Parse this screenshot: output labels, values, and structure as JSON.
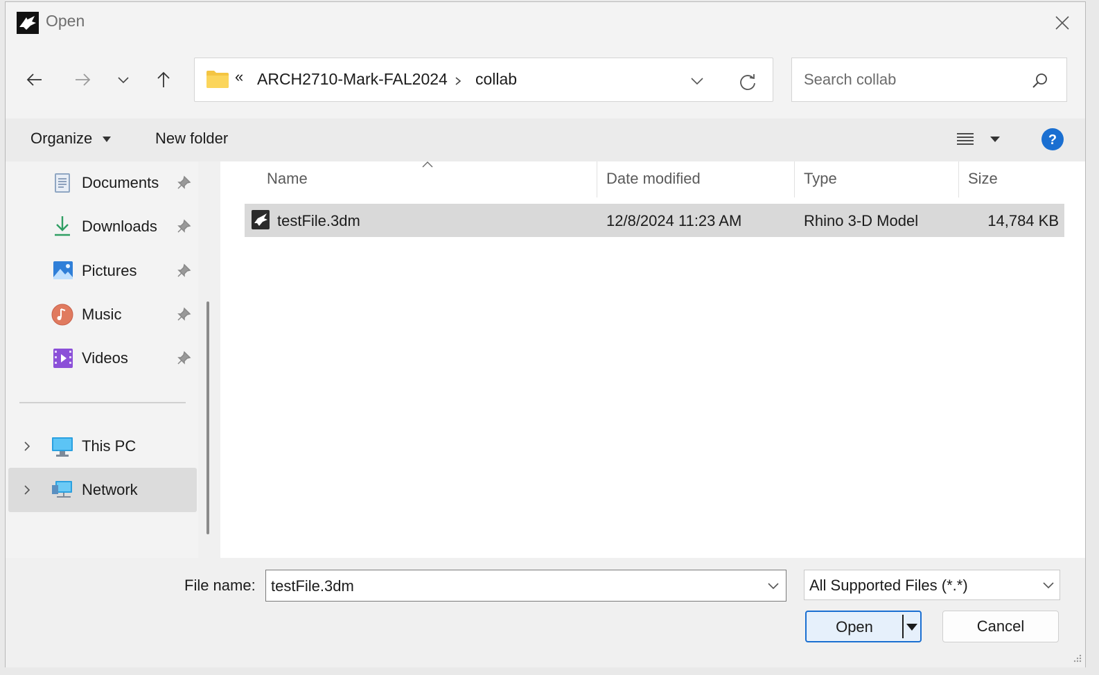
{
  "window": {
    "title": "Open"
  },
  "breadcrumb": {
    "overflow": "«",
    "segments": [
      "ARCH2710-Mark-FAL2024",
      "collab"
    ]
  },
  "search": {
    "placeholder": "Search collab"
  },
  "toolbar": {
    "organize": "Organize",
    "new_folder": "New folder"
  },
  "sidebar": {
    "quick_access": [
      {
        "label": "Documents",
        "icon": "documents-icon"
      },
      {
        "label": "Downloads",
        "icon": "downloads-icon"
      },
      {
        "label": "Pictures",
        "icon": "pictures-icon"
      },
      {
        "label": "Music",
        "icon": "music-icon"
      },
      {
        "label": "Videos",
        "icon": "videos-icon"
      }
    ],
    "locations": [
      {
        "label": "This PC",
        "icon": "this-pc-icon"
      },
      {
        "label": "Network",
        "icon": "network-icon",
        "selected": true
      }
    ]
  },
  "file_list": {
    "columns": [
      "Name",
      "Date modified",
      "Type",
      "Size"
    ],
    "rows": [
      {
        "name": "testFile.3dm",
        "date": "12/8/2024 11:23 AM",
        "type": "Rhino 3-D Model",
        "size": "14,784 KB",
        "selected": true
      }
    ]
  },
  "footer": {
    "file_name_label": "File name:",
    "file_name_value": "testFile.3dm",
    "file_type": "All Supported Files (*.*)",
    "open_label": "Open",
    "cancel_label": "Cancel"
  },
  "colors": {
    "accent": "#1a6fd1",
    "selection": "#d9d9d9",
    "help": "#1a6fd1"
  }
}
